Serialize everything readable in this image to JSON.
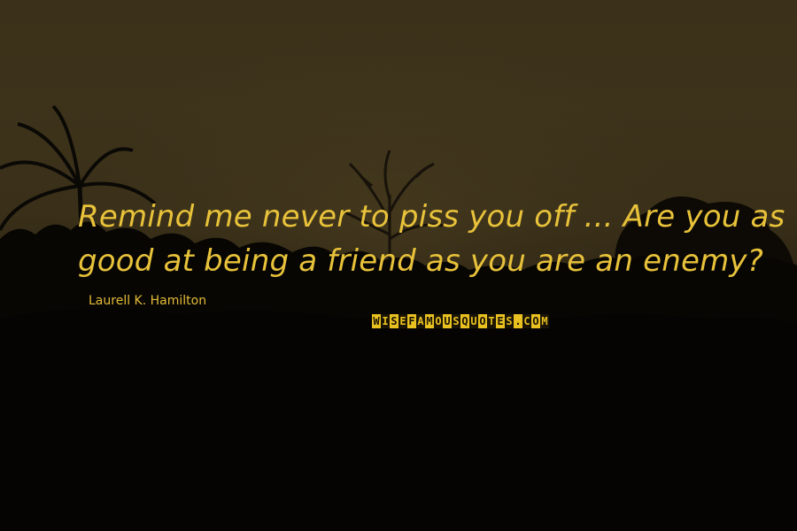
{
  "quote": {
    "lines": [
      "Remind me never to piss you off ... Are you as",
      "good at being a friend as you are an enemy?"
    ],
    "author": "Laurell K. Hamilton"
  },
  "logo": {
    "text": "WISEFAMOUSQUOTES.COM"
  },
  "colors": {
    "quote_text": "#e8c23a",
    "logo_yellow": "#e8c020",
    "sky": "#3b311a"
  }
}
